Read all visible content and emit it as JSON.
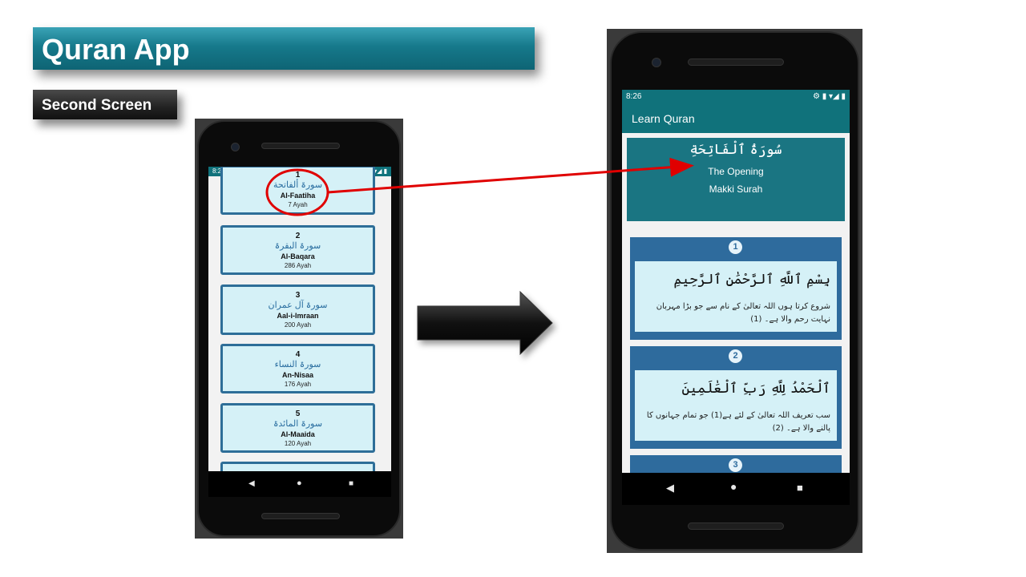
{
  "slide": {
    "title": "Quran App",
    "subtitle": "Second Screen"
  },
  "left_phone": {
    "status": {
      "time": "8:28",
      "icons": "⚙ ▮   ▾◢ ▮"
    },
    "surahs": [
      {
        "number": "1",
        "arabic": "سورۃ ألفاتحة",
        "name": "Al-Faatiha",
        "ayah": "7 Ayah"
      },
      {
        "number": "2",
        "arabic": "سورۃ البقرۃ",
        "name": "Al-Baqara",
        "ayah": "286 Ayah"
      },
      {
        "number": "3",
        "arabic": "سورۃ آل عمران",
        "name": "Aal-i-Imraan",
        "ayah": "200 Ayah"
      },
      {
        "number": "4",
        "arabic": "سورۃ النساء",
        "name": "An-Nisaa",
        "ayah": "176 Ayah"
      },
      {
        "number": "5",
        "arabic": "سورۃ المائدۃ",
        "name": "Al-Maaida",
        "ayah": "120 Ayah"
      }
    ],
    "nav": {
      "back": "◀",
      "home": "●",
      "recent": "■"
    }
  },
  "right_phone": {
    "status": {
      "time": "8:26",
      "icons": "⚙ ▮   ▾◢ ▮"
    },
    "app_title": "Learn Quran",
    "header": {
      "arabic": "سُورَةُ ٱلْفَاتِحَةِ",
      "english": "The Opening",
      "type": "Makki Surah"
    },
    "ayahs": [
      {
        "number": "1",
        "arabic": "بِسْمِ ٱللَّهِ ٱلرَّحْمَٰنِ ٱلرَّحِيمِ",
        "urdu": "شروع کرتا ہوں اللہ تعالیٰ کے نام سے جو بڑا مہربان نہایت رحم والا ہے۔ (1)"
      },
      {
        "number": "2",
        "arabic": "ٱلْحَمْدُ لِلَّهِ رَبِّ ٱلْعَٰلَمِينَ",
        "urdu": "سب تعریف اللہ تعالیٰ کے لئے ہے(1) جو تمام جہانوں کا پالنے والا ہے۔ (2)"
      }
    ],
    "next_ayah_number": "3",
    "nav": {
      "back": "◀",
      "home": "●",
      "recent": "■"
    }
  },
  "colors": {
    "teal": "#10727b",
    "card_bg": "#d5f1f7",
    "card_border": "#2e6e98",
    "highlight": "#e00000"
  }
}
